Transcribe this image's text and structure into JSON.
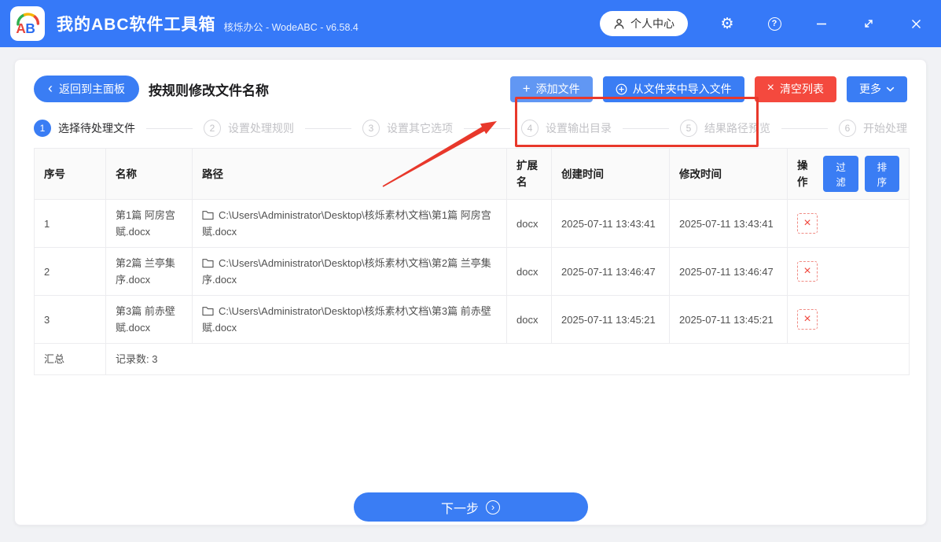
{
  "titlebar": {
    "logo_text": "AB",
    "title": "我的ABC软件工具箱",
    "subtitle": "核烁办公 - WodeABC - v6.58.4",
    "user_center": "个人中心"
  },
  "toolbar": {
    "back_button": "返回到主面板",
    "page_title": "按规则修改文件名称",
    "add_files_button": "添加文件",
    "import_from_folder_button": "从文件夹中导入文件",
    "clear_list_button": "清空列表",
    "more_button": "更多"
  },
  "steps": [
    {
      "num": "1",
      "label": "选择待处理文件",
      "active": true
    },
    {
      "num": "2",
      "label": "设置处理规则",
      "active": false
    },
    {
      "num": "3",
      "label": "设置其它选项",
      "active": false
    },
    {
      "num": "4",
      "label": "设置输出目录",
      "active": false
    },
    {
      "num": "5",
      "label": "结果路径预览",
      "active": false
    },
    {
      "num": "6",
      "label": "开始处理",
      "active": false
    }
  ],
  "table": {
    "headers": {
      "index": "序号",
      "name": "名称",
      "path": "路径",
      "ext": "扩展名",
      "created": "创建时间",
      "modified": "修改时间",
      "actions": "操作"
    },
    "filter_button": "过滤",
    "sort_button": "排序",
    "rows": [
      {
        "index": "1",
        "name": "第1篇 阿房宫赋.docx",
        "path": "C:\\Users\\Administrator\\Desktop\\核烁素材\\文档\\第1篇 阿房宫赋.docx",
        "ext": "docx",
        "created": "2025-07-11 13:43:41",
        "modified": "2025-07-11 13:43:41"
      },
      {
        "index": "2",
        "name": "第2篇 兰亭集序.docx",
        "path": "C:\\Users\\Administrator\\Desktop\\核烁素材\\文档\\第2篇 兰亭集序.docx",
        "ext": "docx",
        "created": "2025-07-11 13:46:47",
        "modified": "2025-07-11 13:46:47"
      },
      {
        "index": "3",
        "name": "第3篇 前赤壁赋.docx",
        "path": "C:\\Users\\Administrator\\Desktop\\核烁素材\\文档\\第3篇 前赤壁赋.docx",
        "ext": "docx",
        "created": "2025-07-11 13:45:21",
        "modified": "2025-07-11 13:45:21"
      }
    ],
    "summary_label": "汇总",
    "summary_value": "记录数: 3"
  },
  "footer": {
    "next_button": "下一步"
  },
  "icons": {
    "back_chevron": "‹",
    "add_plus": "+",
    "clear_x": "×",
    "settings_gear": "⚙",
    "help_question": "?",
    "delete_x": "×",
    "next_arrow": "›"
  },
  "colors": {
    "titlebar_blue": "#3679f8",
    "primary_blue": "#3a7df4",
    "light_blue_button": "#6197f3",
    "danger_red": "#f4493e",
    "annotation_red": "#e8382b"
  }
}
